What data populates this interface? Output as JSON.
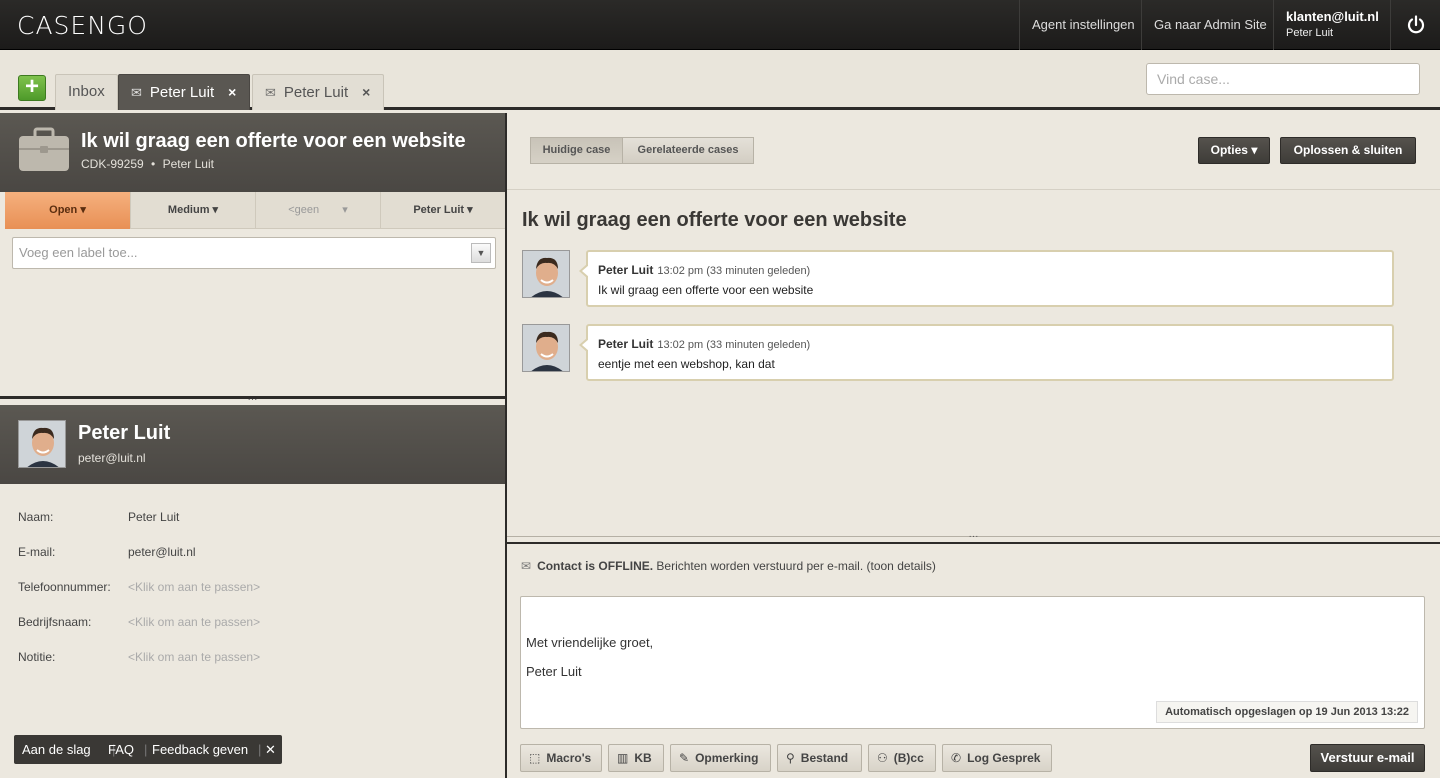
{
  "app": {
    "logo": "CASENGO"
  },
  "topbar": {
    "agent_settings": "Agent instellingen",
    "admin_site": "Ga naar Admin Site",
    "user_email": "klanten@luit.nl",
    "user_name": "Peter Luit",
    "power_icon": "power-icon"
  },
  "tabs": {
    "add_label": "+",
    "inbox": "Inbox",
    "items": [
      {
        "label": "Peter Luit",
        "close": "×",
        "active": true
      },
      {
        "label": "Peter Luit",
        "close": "×",
        "active": false
      }
    ]
  },
  "search": {
    "placeholder": "Vind case..."
  },
  "case": {
    "title": "Ik wil graag een offerte voor een website",
    "id": "CDK-99259",
    "separator": "•",
    "customer": "Peter Luit",
    "status": "Open",
    "priority": "Medium",
    "group": "<geen",
    "agent": "Peter Luit",
    "label_placeholder": "Voeg een label toe..."
  },
  "contact": {
    "name": "Peter Luit",
    "email": "peter@luit.nl",
    "fields": [
      {
        "label": "Naam:",
        "value": "Peter Luit",
        "placeholder": false
      },
      {
        "label": "E-mail:",
        "value": "peter@luit.nl",
        "placeholder": false
      },
      {
        "label": "Telefoonnummer:",
        "value": "<Klik om aan te passen>",
        "placeholder": true
      },
      {
        "label": "Bedrijfsnaam:",
        "value": "<Klik om aan te passen>",
        "placeholder": true
      },
      {
        "label": "Notitie:",
        "value": "<Klik om aan te passen>",
        "placeholder": true
      }
    ]
  },
  "footer": {
    "start": "Aan de slag",
    "faq": "FAQ",
    "feedback": "Feedback geven",
    "sep": "|",
    "close": "✕"
  },
  "toolbar": {
    "current_case": "Huidige case",
    "related_cases": "Gerelateerde cases",
    "options": "Opties ▾",
    "resolve": "Oplossen & sluiten"
  },
  "conversation": {
    "title": "Ik wil graag een offerte voor een website",
    "messages": [
      {
        "author": "Peter Luit",
        "time": "13:02 pm (33 minuten geleden)",
        "body": "Ik wil graag een offerte voor een website"
      },
      {
        "author": "Peter Luit",
        "time": "13:02 pm (33 minuten geleden)",
        "body": "eentje met een webshop, kan dat"
      }
    ]
  },
  "compose": {
    "offline_bold": "Contact is OFFLINE.",
    "offline_rest": " Berichten worden verstuurd per e-mail. (toon details)",
    "greeting": "Met vriendelijke groet,",
    "signature": "Peter Luit",
    "autosave": "Automatisch opgeslagen op 19 Jun 2013 13:22",
    "buttons": {
      "macros": "Macro's",
      "kb": "KB",
      "note": "Opmerking",
      "file": "Bestand",
      "bcc": "(B)cc",
      "log_call": "Log Gesprek"
    },
    "send": "Verstuur e-mail"
  }
}
